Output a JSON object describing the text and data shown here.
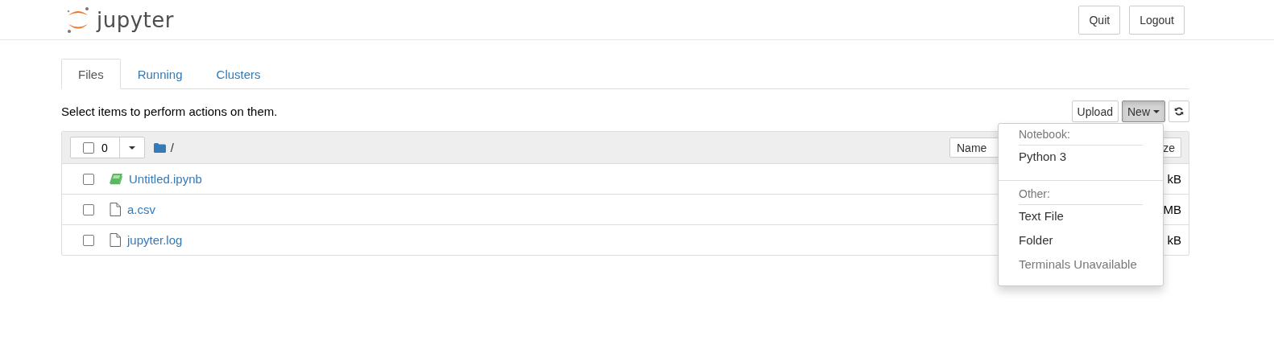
{
  "header": {
    "logo_text": "jupyter",
    "buttons": [
      "Quit",
      "Logout"
    ]
  },
  "tabs": [
    {
      "label": "Files",
      "selected": true
    },
    {
      "label": "Running",
      "selected": false
    },
    {
      "label": "Clusters",
      "selected": false
    }
  ],
  "toolbar": {
    "hint": "Select items to perform actions on them.",
    "upload": "Upload",
    "new": "New",
    "new_open": true
  },
  "list_header": {
    "select_all_checked": false,
    "selected_count": "0",
    "path": "/",
    "sort_button": "Name",
    "size_button": "ze"
  },
  "files": [
    {
      "kind": "notebook",
      "name": "Untitled.ipynb",
      "checked": false,
      "size": "kB"
    },
    {
      "kind": "file",
      "name": "a.csv",
      "checked": false,
      "size": "MB"
    },
    {
      "kind": "file",
      "name": "jupyter.log",
      "checked": false,
      "size": "kB"
    }
  ],
  "new_menu": [
    {
      "header": "Notebook:",
      "items": [
        {
          "label": "Python 3",
          "disabled": false
        }
      ]
    },
    {
      "header": "Other:",
      "items": [
        {
          "label": "Text File",
          "disabled": false
        },
        {
          "label": "Folder",
          "disabled": false
        },
        {
          "label": "Terminals Unavailable",
          "disabled": true
        }
      ]
    }
  ]
}
